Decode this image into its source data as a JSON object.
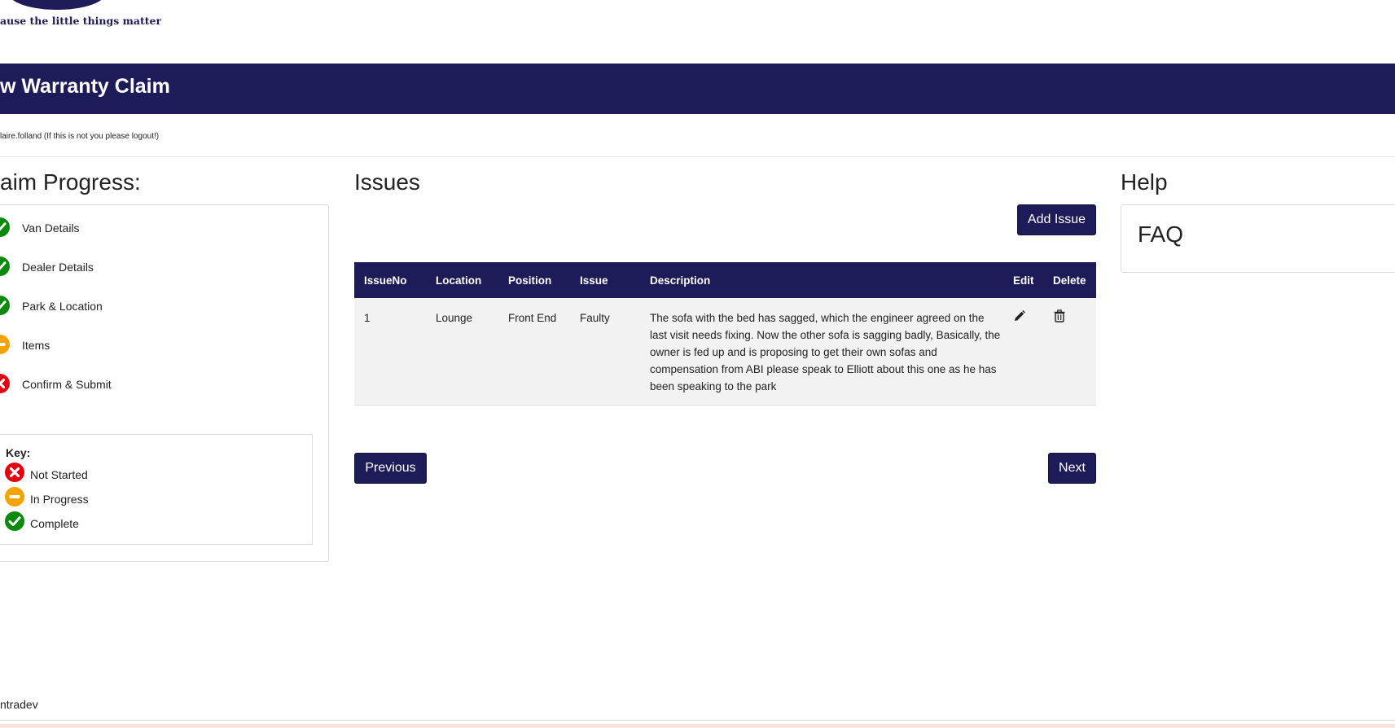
{
  "header": {
    "tagline": "ause the little things matter",
    "title": "w Warranty Claim",
    "user_line": "laire.folland (If this is not you please logout!)"
  },
  "progress": {
    "heading": "aim Progress:",
    "steps": [
      {
        "label": "Van Details",
        "status": "complete"
      },
      {
        "label": "Dealer Details",
        "status": "complete"
      },
      {
        "label": "Park & Location",
        "status": "complete"
      },
      {
        "label": "Items",
        "status": "in-progress"
      },
      {
        "label": "Confirm & Submit",
        "status": "not-started"
      }
    ],
    "key": {
      "title": "Key:",
      "not_started": "Not Started",
      "in_progress": "In Progress",
      "complete": "Complete"
    }
  },
  "issues": {
    "heading": "Issues",
    "add_label": "Add Issue",
    "columns": [
      "IssueNo",
      "Location",
      "Position",
      "Issue",
      "Description",
      "Edit",
      "Delete"
    ],
    "rows": [
      {
        "issue_no": "1",
        "location": "Lounge",
        "position": "Front End",
        "issue": "Faulty",
        "description": "The sofa with the bed has sagged, which the engineer agreed on the last visit needs fixing. Now the other sofa is sagging badly, Basically, the owner is fed up and is proposing to get their own sofas and compensation from ABI please speak to Elliott about this one as he has been speaking to the park"
      }
    ],
    "prev_label": "Previous",
    "next_label": "Next"
  },
  "help": {
    "heading": "Help",
    "faq_label": "FAQ"
  },
  "footer": {
    "text": "ntradev"
  },
  "icons": {
    "complete": "check-circle-icon",
    "in_progress": "minus-circle-icon",
    "not_started": "x-circle-icon",
    "edit": "pencil-icon",
    "delete": "trash-icon"
  },
  "colors": {
    "brand": "#1d1b58",
    "complete": "#0a8a0a",
    "in_progress": "#f5a300",
    "not_started": "#e4000f"
  }
}
